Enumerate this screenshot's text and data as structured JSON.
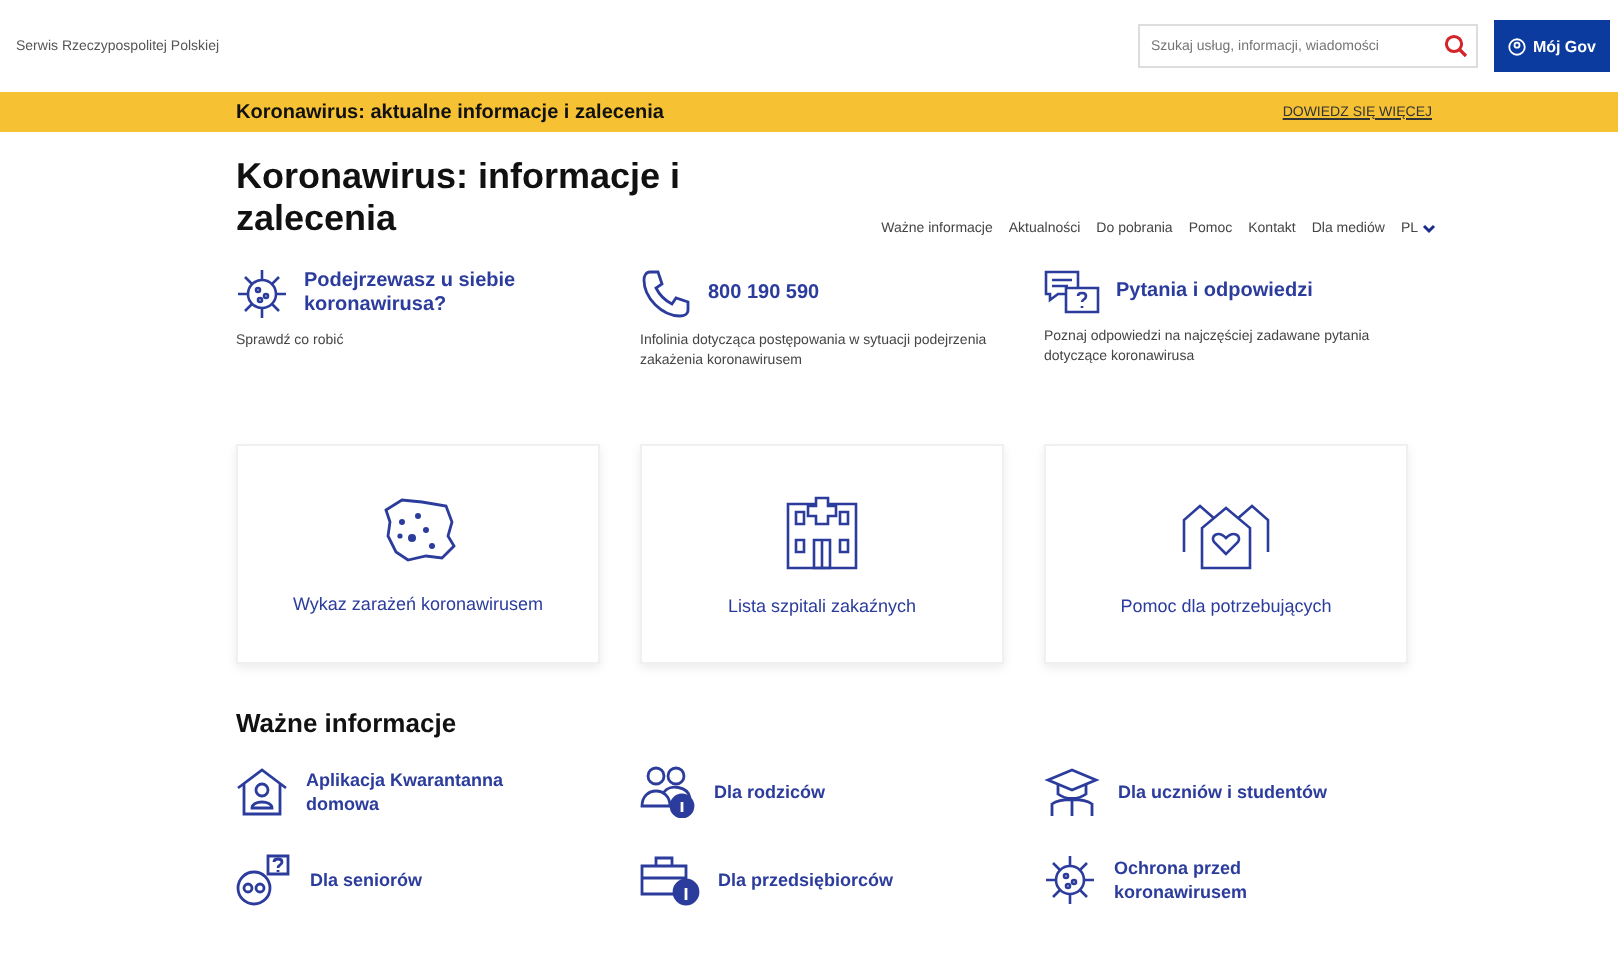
{
  "header": {
    "site_name": "Serwis Rzeczypospolitej Polskiej",
    "search": {
      "placeholder": "Szukaj usług, informacji, wiadomości"
    },
    "account_button": "Mój Gov"
  },
  "banner": {
    "text": "Koronawirus: aktualne informacje i zalecenia",
    "link": "DOWIEDZ SIĘ WIĘCEJ"
  },
  "title": "Koronawirus: informacje i zalecenia",
  "nav": {
    "items": [
      "Ważne informacje",
      "Aktualności",
      "Do pobrania",
      "Pomoc",
      "Kontakt",
      "Dla mediów"
    ],
    "language": "PL"
  },
  "quick_links": [
    {
      "kind": "virus",
      "title": "Podejrzewasz u siebie koronawirusa?",
      "description": "Sprawdź co robić"
    },
    {
      "kind": "phone",
      "title": "800 190 590",
      "description": "Infolinia dotycząca postępowania w sytuacji podejrzenia zakażenia koronawirusem"
    },
    {
      "kind": "qa",
      "title": "Pytania i odpowiedzi",
      "description": "Poznaj odpowiedzi na najczęściej zadawane pytania dotyczące koronawirusa"
    }
  ],
  "cards": [
    {
      "kind": "map",
      "label": "Wykaz zarażeń koronawirusem"
    },
    {
      "kind": "hospital",
      "label": "Lista szpitali zakaźnych"
    },
    {
      "kind": "houses",
      "label": "Pomoc dla potrzebujących"
    }
  ],
  "important": {
    "heading": "Ważne informacje",
    "items": [
      {
        "kind": "home-person",
        "label": "Aplikacja Kwarantanna domowa"
      },
      {
        "kind": "parents",
        "label": "Dla rodziców"
      },
      {
        "kind": "graduate",
        "label": "Dla uczniów i studentów"
      },
      {
        "kind": "senior",
        "label": "Dla seniorów"
      },
      {
        "kind": "briefcase",
        "label": "Dla przedsiębiorców"
      },
      {
        "kind": "virus",
        "label": "Ochrona przed koronawirusem"
      }
    ]
  }
}
